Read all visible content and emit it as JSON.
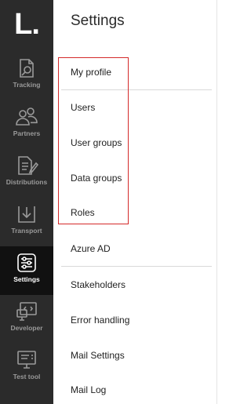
{
  "app": {
    "logo_text": "L."
  },
  "rail": {
    "items": [
      {
        "label": "Tracking",
        "icon": "tracking-icon",
        "active": false
      },
      {
        "label": "Partners",
        "icon": "partners-icon",
        "active": false
      },
      {
        "label": "Distributions",
        "icon": "distributions-icon",
        "active": false
      },
      {
        "label": "Transport",
        "icon": "transport-icon",
        "active": false
      },
      {
        "label": "Settings",
        "icon": "settings-icon",
        "active": true
      },
      {
        "label": "Developer",
        "icon": "developer-icon",
        "active": false
      },
      {
        "label": "Test tool",
        "icon": "test-tool-icon",
        "active": false
      }
    ]
  },
  "settings": {
    "title": "Settings",
    "items": [
      {
        "label": "My profile"
      },
      {
        "label": "Users"
      },
      {
        "label": "User groups"
      },
      {
        "label": "Data groups"
      },
      {
        "label": "Roles"
      },
      {
        "label": "Azure AD"
      },
      {
        "label": "Stakeholders"
      },
      {
        "label": "Error handling"
      },
      {
        "label": "Mail Settings"
      },
      {
        "label": "Mail Log"
      }
    ]
  },
  "colors": {
    "rail_bg": "#2b2b2b",
    "rail_active_bg": "#111111",
    "highlight": "#d42a2a"
  }
}
